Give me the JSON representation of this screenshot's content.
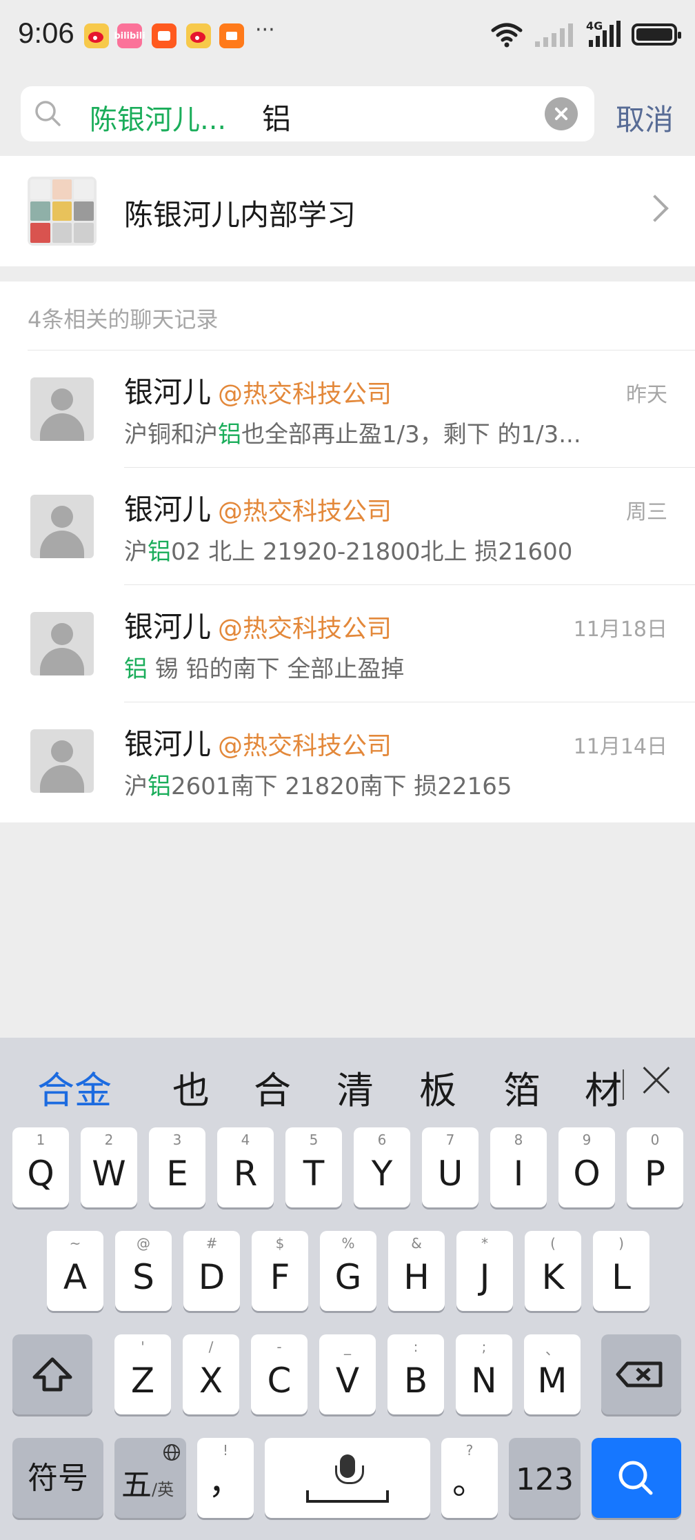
{
  "status": {
    "time": "9:06",
    "more": "···",
    "network": "4G",
    "apps": [
      "bilibili"
    ]
  },
  "search": {
    "scope": "陈银河儿...",
    "query": "铝",
    "cancel": "取消"
  },
  "group": {
    "name": "陈银河儿内部学习"
  },
  "results": {
    "header": "4条相关的聊天记录",
    "items": [
      {
        "sender": "银河儿",
        "org": "@热交科技公司",
        "time": "昨天",
        "snip_a": "沪铜和沪",
        "snip_hl": "铝",
        "snip_b": "也全部再止盈1/3，剩下 的1/3..."
      },
      {
        "sender": "银河儿",
        "org": "@热交科技公司",
        "time": "周三",
        "snip_a": "沪",
        "snip_hl": "铝",
        "snip_b": "02 北上  21920-21800北上 损21600"
      },
      {
        "sender": "银河儿",
        "org": "@热交科技公司",
        "time": "11月18日",
        "snip_a": "",
        "snip_hl": "铝",
        "snip_b": " 锡 铅的南下   全部止盈掉"
      },
      {
        "sender": "银河儿",
        "org": "@热交科技公司",
        "time": "11月14日",
        "snip_a": "沪",
        "snip_hl": "铝",
        "snip_b": "2601南下   21820南下   损22165"
      }
    ]
  },
  "keyboard": {
    "candidates": [
      "合金",
      "也",
      "合",
      "清",
      "板",
      "箔",
      "材"
    ],
    "row1": [
      {
        "k": "Q",
        "s": "1"
      },
      {
        "k": "W",
        "s": "2"
      },
      {
        "k": "E",
        "s": "3"
      },
      {
        "k": "R",
        "s": "4"
      },
      {
        "k": "T",
        "s": "5"
      },
      {
        "k": "Y",
        "s": "6"
      },
      {
        "k": "U",
        "s": "7"
      },
      {
        "k": "I",
        "s": "8"
      },
      {
        "k": "O",
        "s": "9"
      },
      {
        "k": "P",
        "s": "0"
      }
    ],
    "row2": [
      {
        "k": "A",
        "s": "~"
      },
      {
        "k": "S",
        "s": "@"
      },
      {
        "k": "D",
        "s": "#"
      },
      {
        "k": "F",
        "s": "$"
      },
      {
        "k": "G",
        "s": "%"
      },
      {
        "k": "H",
        "s": "&"
      },
      {
        "k": "J",
        "s": "*"
      },
      {
        "k": "K",
        "s": "("
      },
      {
        "k": "L",
        "s": ")"
      }
    ],
    "row3": [
      {
        "k": "Z",
        "s": "'"
      },
      {
        "k": "X",
        "s": "/"
      },
      {
        "k": "C",
        "s": "-"
      },
      {
        "k": "V",
        "s": "_"
      },
      {
        "k": "B",
        "s": ":"
      },
      {
        "k": "N",
        "s": ";"
      },
      {
        "k": "M",
        "s": "、"
      }
    ],
    "symbols": "符号",
    "lang": "五",
    "lang_sub": "/英",
    "comma": "，",
    "comma_sub": "!",
    "period": "。",
    "period_sub": "?",
    "num": "123"
  },
  "colors": {
    "accent_green": "#1aad5a",
    "org_orange": "#e3883a",
    "link_blue": "#576b95",
    "search_key_blue": "#1677ff"
  }
}
